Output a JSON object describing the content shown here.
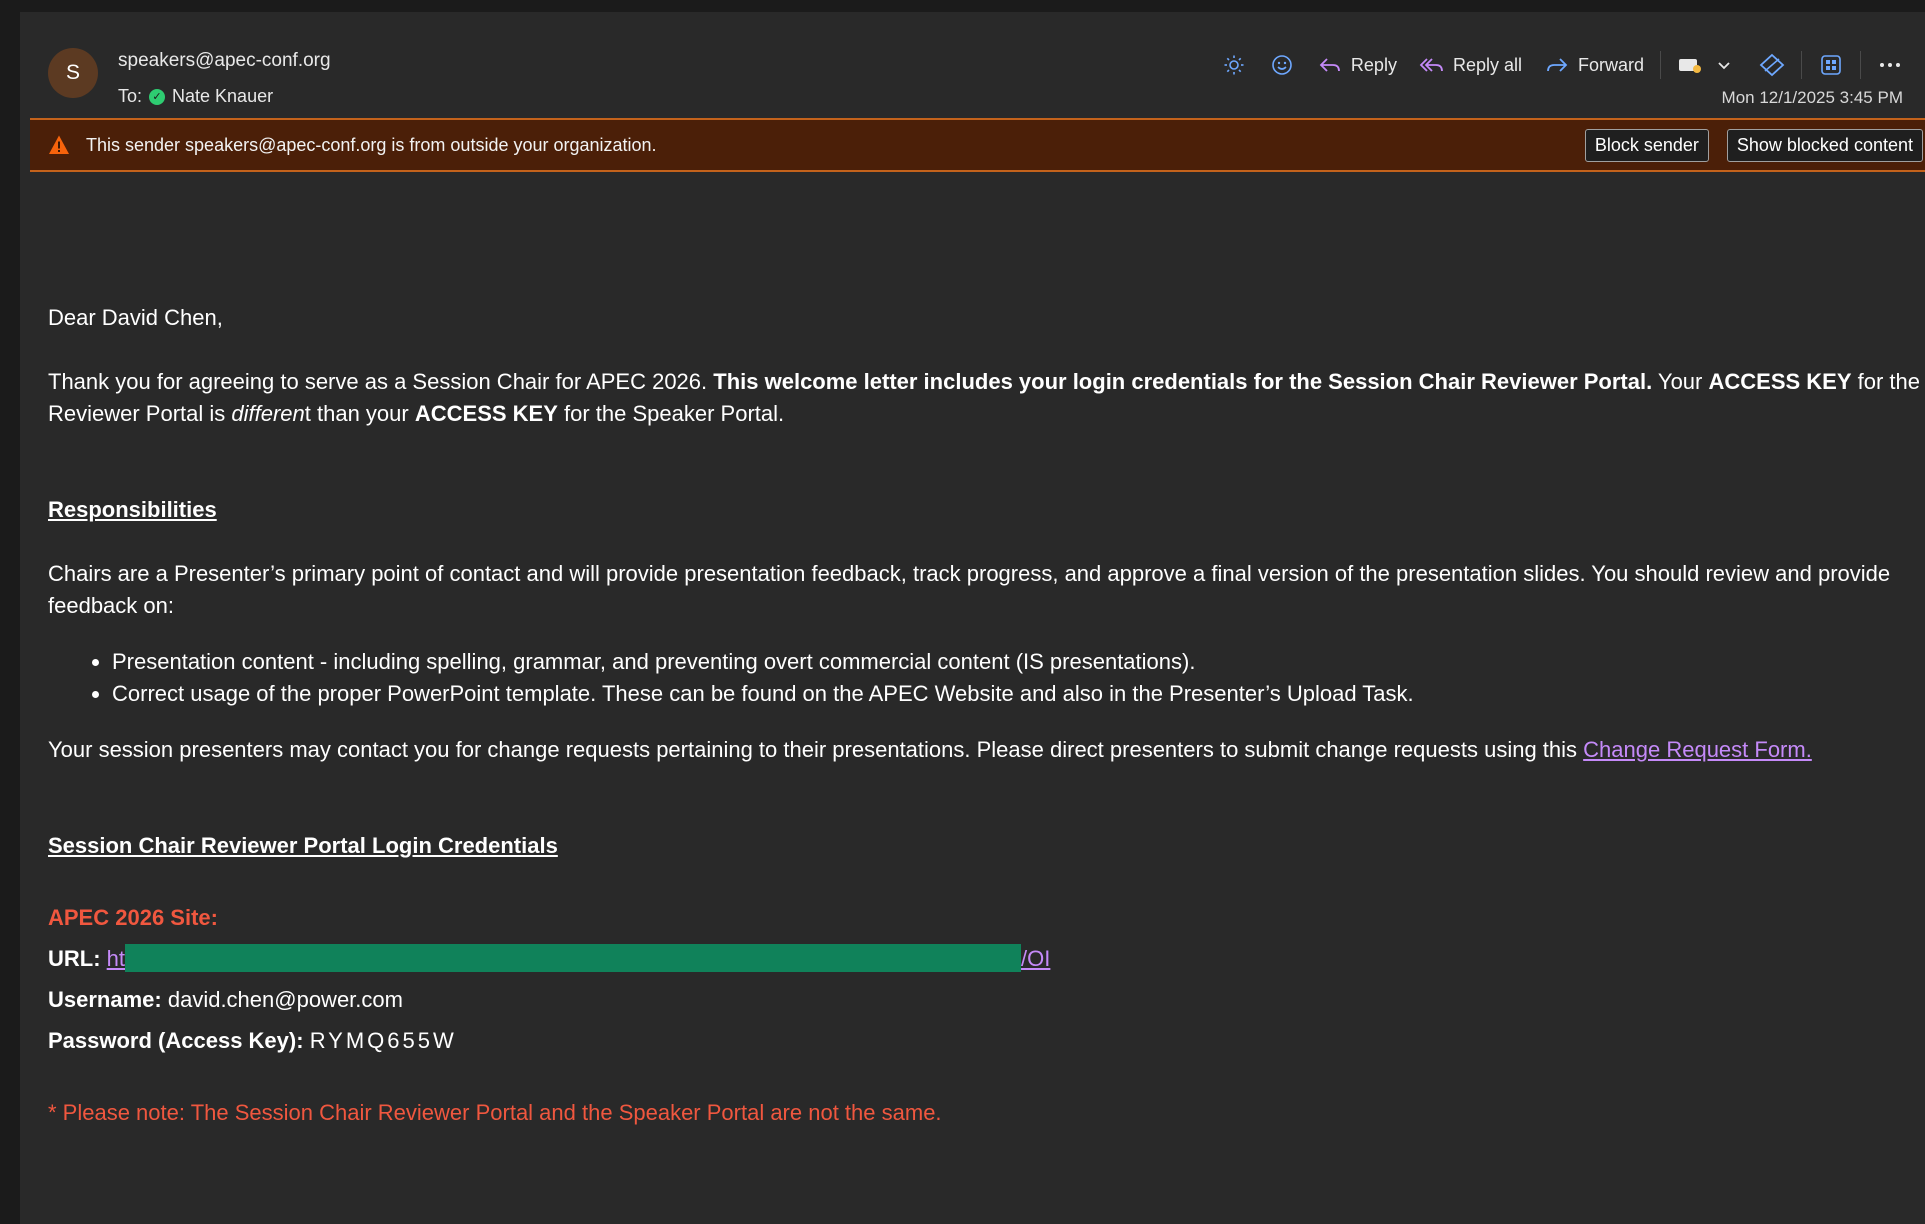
{
  "sender": {
    "avatar_initial": "S",
    "email": "speakers@apec-conf.org",
    "to_label": "To:",
    "to_name": "Nate Knauer"
  },
  "toolbar": {
    "reply": "Reply",
    "reply_all": "Reply all",
    "forward": "Forward",
    "timestamp": "Mon 12/1/2025 3:45 PM"
  },
  "banner": {
    "text": "This sender speakers@apec-conf.org is from outside your organization.",
    "block_sender": "Block sender",
    "show_blocked": "Show blocked content"
  },
  "email": {
    "greeting": "Dear David Chen,",
    "intro_1": "Thank you for agreeing to serve as a Session Chair for APEC 2026. ",
    "intro_bold": "This welcome letter includes your login credentials for the Session Chair Reviewer Portal.",
    "intro_2": " Your ",
    "intro_access_key_1": "ACCESS KEY",
    "intro_3": " for the Reviewer Portal is ",
    "intro_italic": "differen",
    "intro_4": "t than your ",
    "intro_access_key_2": "ACCESS KEY",
    "intro_5": " for the Speaker Portal.",
    "responsibilities_heading": "Responsibilities",
    "responsibilities_text": "Chairs are a Presenter’s primary point of contact and will provide presentation feedback, track progress, and approve a final version of the presentation slides. You should review and provide feedback on:",
    "bullets": [
      "Presentation content - including spelling, grammar, and preventing overt commercial content (IS presentations).",
      "Correct usage of the proper PowerPoint template. These can be found on the APEC Website and also in the Presenter’s Upload Task."
    ],
    "change_request_text": "Your session presenters may contact you for change requests pertaining to their presentations. Please direct presenters to submit change requests using this ",
    "change_request_link": "Change Request Form.",
    "credentials_heading": "Session Chair Reviewer Portal Login Credentials",
    "site_label": "APEC 2026 Site:",
    "url_label": "URL:",
    "url_prefix": "ht",
    "url_suffix": "/OI",
    "username_label": "Username:",
    "username_value": "david.chen@power.com",
    "password_label": "Password (Access Key):",
    "password_value": "RYMQ655W",
    "note": "* Please note: The Session Chair Reviewer Portal and the Speaker Portal are not the same."
  },
  "colors": {
    "accent_link": "#c58af9",
    "warning_banner": "#4b1f08",
    "warning_border": "#c4621b",
    "note_red": "#f0573f",
    "redaction": "#10825a"
  }
}
